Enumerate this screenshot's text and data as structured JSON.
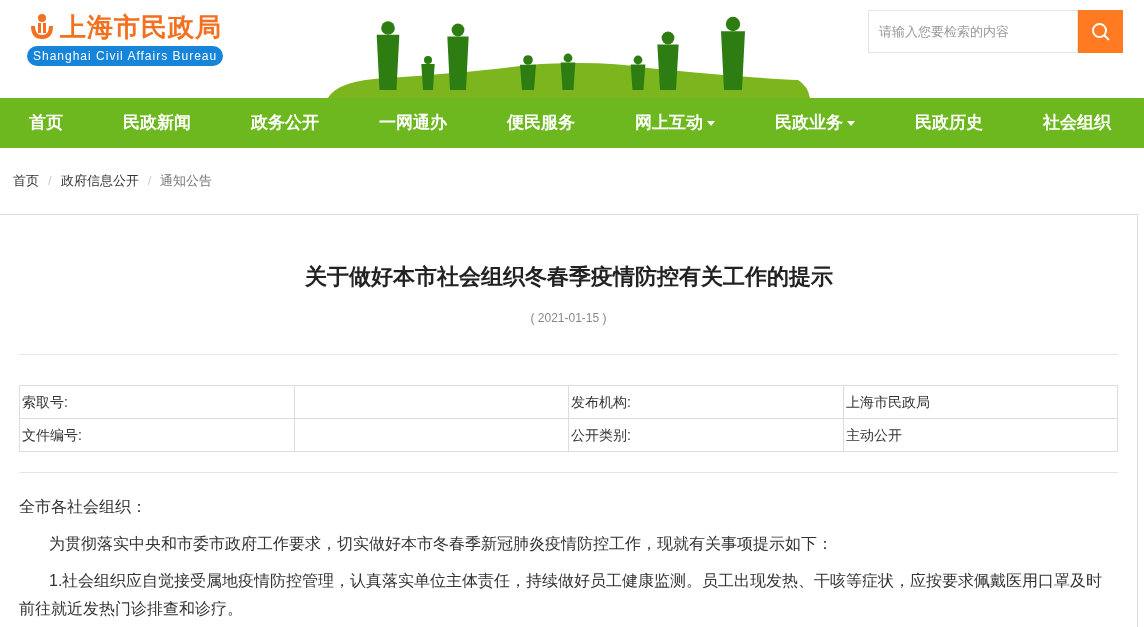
{
  "header": {
    "logo_title": "上海市民政局",
    "logo_subtitle": "Shanghai Civil Affairs Bureau",
    "search": {
      "placeholder": "请输入您要检索的内容"
    }
  },
  "nav": [
    {
      "label": "首页",
      "dropdown": false
    },
    {
      "label": "民政新闻",
      "dropdown": false
    },
    {
      "label": "政务公开",
      "dropdown": false
    },
    {
      "label": "一网通办",
      "dropdown": false
    },
    {
      "label": "便民服务",
      "dropdown": false
    },
    {
      "label": "网上互动",
      "dropdown": true
    },
    {
      "label": "民政业务",
      "dropdown": true
    },
    {
      "label": "民政历史",
      "dropdown": false
    },
    {
      "label": "社会组织",
      "dropdown": false
    }
  ],
  "breadcrumb": [
    {
      "label": "首页",
      "current": false
    },
    {
      "separator": "/",
      "label": "政府信息公开",
      "current": false
    },
    {
      "separator": "/",
      "label": "通知公告",
      "current": true
    }
  ],
  "article": {
    "title": "关于做好本市社会组织冬春季疫情防控有关工作的提示",
    "date": "( 2021-01-15 )",
    "info_table": [
      {
        "column_1": "索取号:",
        "column_3": "发布机构:",
        "column_4": "上海市民政局"
      },
      {
        "column_1": "文件编号:",
        "column_3": "公开类别:",
        "column_4": "主动公开"
      }
    ],
    "paragraphs": [
      {
        "text": "全市各社会组织：",
        "indent": false
      },
      {
        "text": "为贯彻落实中央和市委市政府工作要求，切实做好本市冬春季新冠肺炎疫情防控工作，现就有关事项提示如下：",
        "indent": true
      },
      {
        "text": "1.社会组织应自觉接受属地疫情防控管理，认真落实单位主体责任，持续做好员工健康监测。员工出现发热、干咳等症状，应按要求佩戴医用口罩及时前往就近发热门诊排查和诊疗。",
        "indent": true
      }
    ]
  }
}
